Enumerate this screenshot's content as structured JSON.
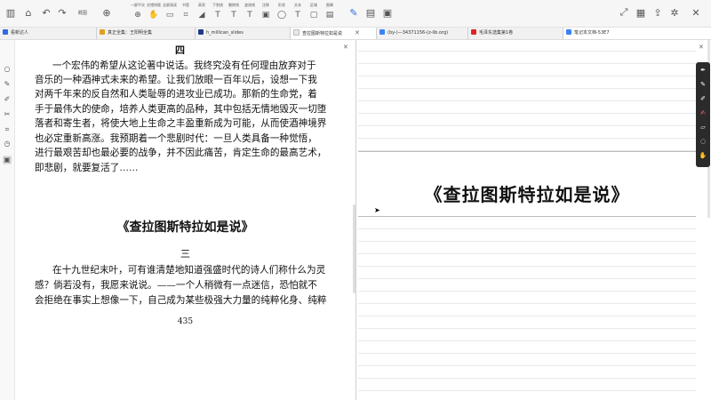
{
  "toolbar": {
    "left_icons": [
      "sidebar-icon",
      "bank-icon",
      "undo-icon",
      "redo-icon"
    ],
    "outline_label": "概图",
    "tools": [
      {
        "label": "一屏平次",
        "icon": "⊕"
      },
      {
        "label": "交错排版",
        "icon": "✋"
      },
      {
        "label": "全屏阅读",
        "icon": "▭"
      },
      {
        "label": "书签",
        "icon": "⌗"
      },
      {
        "label": "高亮",
        "icon": "◢"
      },
      {
        "label": "下划线",
        "icon": "T"
      },
      {
        "label": "删除线",
        "icon": "T"
      },
      {
        "label": "波浪线",
        "icon": "T"
      },
      {
        "label": "注释",
        "icon": "▣"
      },
      {
        "label": "形状",
        "icon": "◯"
      },
      {
        "label": "文本",
        "icon": "T"
      },
      {
        "label": "区域",
        "icon": "▢"
      },
      {
        "label": "图章",
        "icon": "▤"
      }
    ]
  },
  "tabs": [
    {
      "label": "看新达人",
      "color": "#2d6cdf"
    },
    {
      "label": "真正全集：王阳明全集",
      "color": "#e0a020"
    },
    {
      "label": "h_millican_slides",
      "color": "#1e3a8a"
    },
    {
      "label": "查拉图斯特拉如是说",
      "color": "#eeeeee"
    },
    {
      "label": "(by-)—34371156-(z-lib.org)",
      "color": "#3b82f6"
    },
    {
      "label": "毛泽东选集第1卷",
      "color": "#dc2626"
    },
    {
      "label": "笔记本文档-53E7",
      "color": "#3b82f6"
    }
  ],
  "book": {
    "head_glyph": "四",
    "lines": [
      "一个宏伟的希望从这论著中说话。我终究没有任何理由放弃对于",
      "音乐的一种酒神式未来的希望。让我们放眼一百年以后，设想一下我",
      "对两千年来的反自然和人类耻辱的进攻业已成功。那新的生命党，着",
      "手于最伟大的使命，培养人类更高的品种，其中包括无情地毁灭一切堕",
      "落者和寄生者，将使大地上生命之丰盈重新成为可能，从而使酒神境界",
      "也必定重新高涨。我预期着一个悲剧时代：一旦人类具备一种觉悟，",
      "进行最艰苦却也最必要的战争，并不因此痛苦，肯定生命的最高艺术，",
      "即悲剧，就要复活了……"
    ],
    "chapter_title": "《查拉图斯特拉如是说》",
    "section_no": "三",
    "lines2": [
      "在十九世纪末叶，可有谁清楚地知道强盛时代的诗人们称什么为灵",
      "感？倘若没有，我愿来说说。——一个人稍微有一点迷信，恐怕就不",
      "会拒绝在事实上想像一下，自己成为某些极强大力量的纯粹化身、纯粹"
    ],
    "page_number": "435"
  },
  "notes": {
    "title": "《查拉图斯特拉如是说》"
  },
  "pen_tools": [
    "pen-icon",
    "pencil-icon",
    "highlighter-icon",
    "marker-icon",
    "eraser-icon",
    "lasso-icon",
    "hand-icon"
  ],
  "sidebar_icons": [
    "circle-icon",
    "edit-icon",
    "pen-icon",
    "scissors-icon",
    "crop-icon",
    "timer-icon",
    "layers-icon"
  ]
}
